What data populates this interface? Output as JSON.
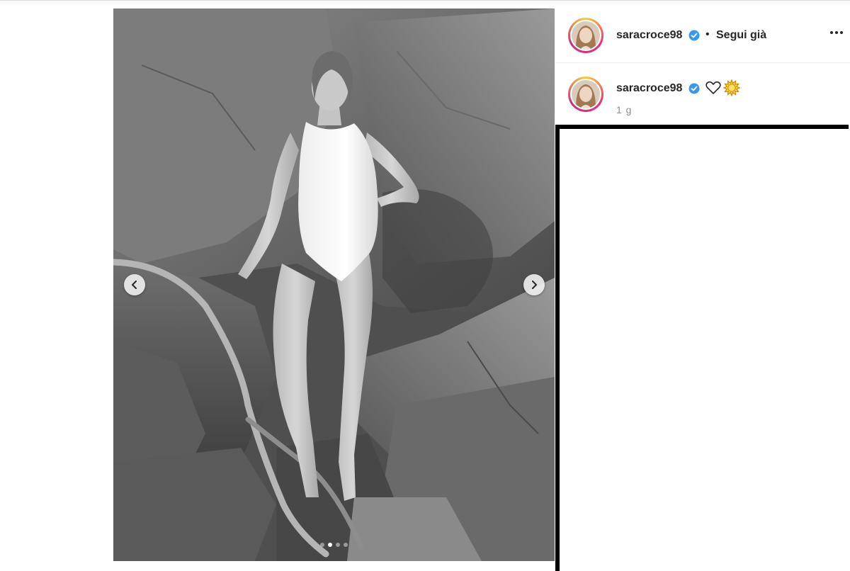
{
  "post": {
    "author": "saracroce98",
    "verified": true,
    "separator": "•",
    "follow_label": "Segui già",
    "more_icon": "more-horizontal-icon",
    "caption": {
      "author": "saracroce98",
      "emojis": [
        "heart-outline-icon",
        "sun-icon"
      ]
    },
    "time_ago": "1 g"
  },
  "carousel": {
    "slide_count": 4,
    "active_index": 1,
    "prev_icon": "chevron-left-icon",
    "next_icon": "chevron-right-icon"
  },
  "colors": {
    "verified_badge": "#3897f0",
    "text_primary": "#262626",
    "text_secondary": "#8e8e8e",
    "story_ring_start": "#f9ce34",
    "story_ring_mid": "#ee2a7b",
    "story_ring_end": "#c13584"
  }
}
